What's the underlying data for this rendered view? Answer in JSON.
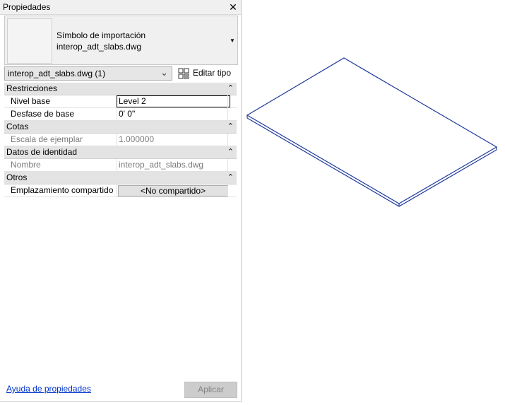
{
  "panel": {
    "title": "Propiedades",
    "close_icon": "close-icon"
  },
  "type_selector": {
    "line1": "Símbolo de importación",
    "line2": "interop_adt_slabs.dwg"
  },
  "instance": {
    "value": "interop_adt_slabs.dwg (1)",
    "edit_type_label": "Editar tipo"
  },
  "groups": [
    {
      "label": "Restricciones"
    },
    {
      "label": "Cotas"
    },
    {
      "label": "Datos de identidad"
    },
    {
      "label": "Otros"
    }
  ],
  "params": {
    "base_level": {
      "name": "Nivel base",
      "value": "Level 2"
    },
    "base_offset": {
      "name": "Desfase de base",
      "value": "0'  0\""
    },
    "instance_scale": {
      "name": "Escala de ejemplar",
      "value": "1.000000"
    },
    "name": {
      "name": "Nombre",
      "value": "interop_adt_slabs.dwg"
    },
    "shared_site": {
      "name": "Emplazamiento compartido",
      "value": "<No compartido>"
    }
  },
  "footer": {
    "help_link": "Ayuda de propiedades",
    "apply": "Aplicar"
  },
  "colors": {
    "model_line": "#1f3a9a",
    "link": "#0033cc"
  }
}
